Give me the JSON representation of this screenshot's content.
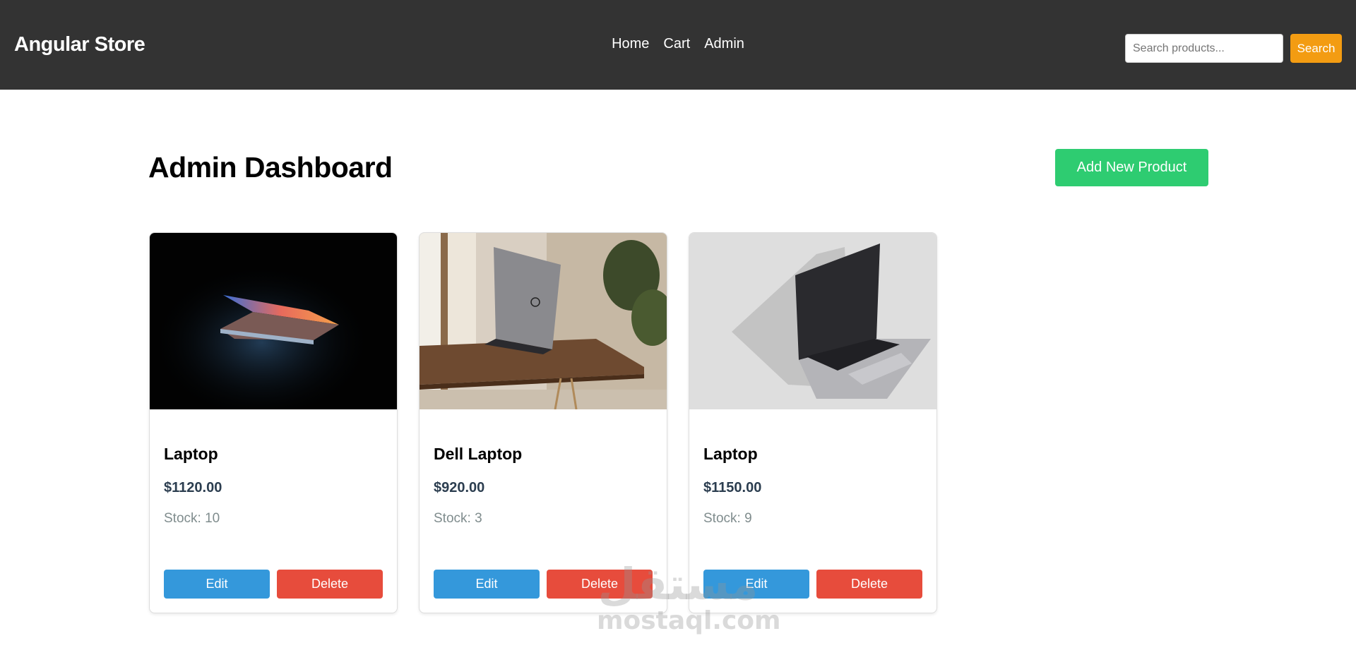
{
  "header": {
    "brand": "Angular Store",
    "nav": [
      {
        "label": "Home"
      },
      {
        "label": "Cart"
      },
      {
        "label": "Admin"
      }
    ],
    "search": {
      "placeholder": "Search products...",
      "value": "",
      "button_label": "Search"
    }
  },
  "main": {
    "title": "Admin Dashboard",
    "add_button_label": "Add New Product",
    "products": [
      {
        "name": "Laptop",
        "price": "$1120.00",
        "stock_label": "Stock:",
        "stock": "10",
        "edit_label": "Edit",
        "delete_label": "Delete"
      },
      {
        "name": "Dell Laptop",
        "price": "$920.00",
        "stock_label": "Stock:",
        "stock": "3",
        "edit_label": "Edit",
        "delete_label": "Delete"
      },
      {
        "name": "Laptop",
        "price": "$1150.00",
        "stock_label": "Stock:",
        "stock": "9",
        "edit_label": "Edit",
        "delete_label": "Delete"
      }
    ]
  },
  "watermark": {
    "arabic": "مستقل",
    "latin": "mostaql.com"
  },
  "colors": {
    "header_bg": "#333333",
    "search_button": "#f39c12",
    "add_button": "#2ecc71",
    "edit_button": "#3498db",
    "delete_button": "#e74c3c",
    "price_text": "#2c3e50",
    "stock_text": "#7f8c8d"
  }
}
